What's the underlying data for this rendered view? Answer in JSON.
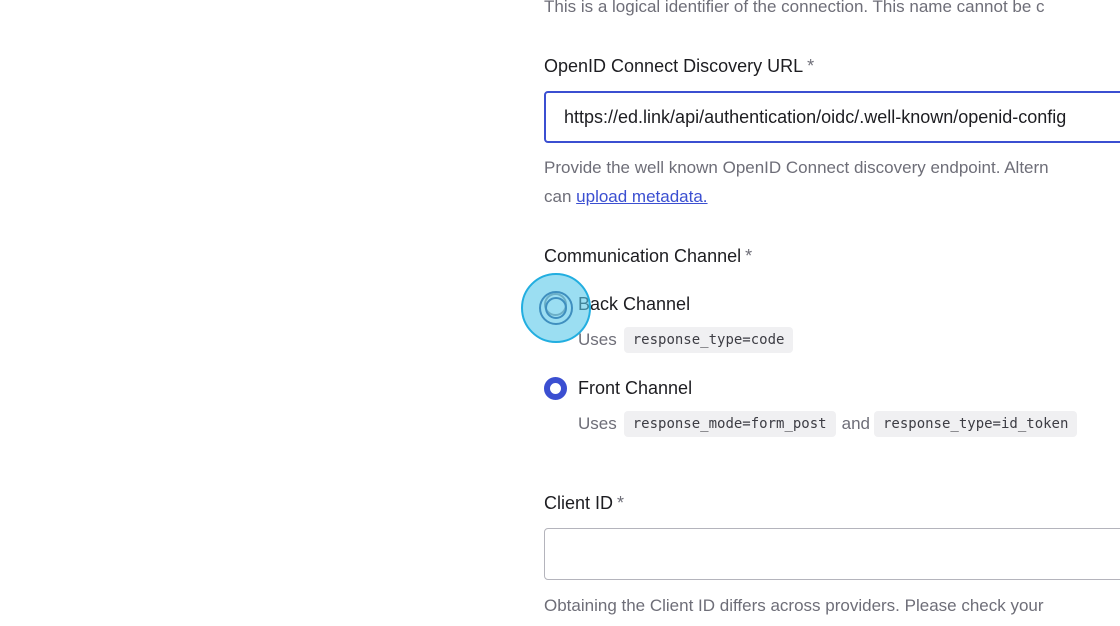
{
  "name_field": {
    "help_text": "This is a logical identifier of the connection. This name cannot be c"
  },
  "discovery_url": {
    "label": "OpenID Connect Discovery URL",
    "required_mark": "*",
    "value": "https://ed.link/api/authentication/oidc/.well-known/openid-config",
    "help_text": "Provide the well known OpenID Connect discovery endpoint. Altern",
    "help_text_prefix": "can",
    "upload_link": "upload metadata."
  },
  "communication_channel": {
    "label": "Communication Channel",
    "required_mark": "*",
    "options": [
      {
        "label": "Back Channel",
        "checked": false,
        "uses_label": "Uses",
        "codes": [
          "response_type=code"
        ]
      },
      {
        "label": "Front Channel",
        "checked": true,
        "uses_label": "Uses",
        "codes": [
          "response_mode=form_post",
          "response_type=id_token"
        ],
        "joiner": "and"
      }
    ]
  },
  "client_id": {
    "label": "Client ID",
    "required_mark": "*",
    "value": "",
    "help_text": "Obtaining the Client ID differs across providers. Please check your"
  },
  "colors": {
    "accent": "#3b4fd1",
    "click_indicator": "#58c8ea"
  }
}
